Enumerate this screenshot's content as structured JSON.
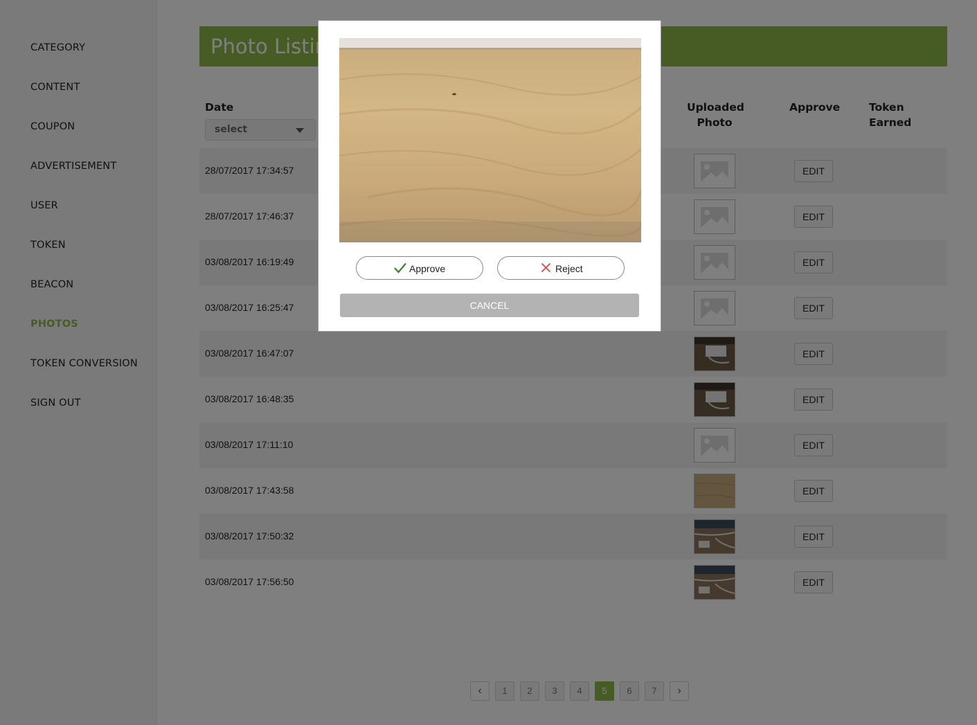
{
  "sidebar": {
    "items": [
      {
        "label": "CATEGORY"
      },
      {
        "label": "CONTENT"
      },
      {
        "label": "COUPON"
      },
      {
        "label": "ADVERTISEMENT"
      },
      {
        "label": "USER"
      },
      {
        "label": "TOKEN"
      },
      {
        "label": "BEACON"
      },
      {
        "label": "PHOTOS",
        "active": true
      },
      {
        "label": "TOKEN CONVERSION"
      },
      {
        "label": "SIGN OUT"
      }
    ]
  },
  "page": {
    "title": "Photo Listing"
  },
  "table": {
    "headers": {
      "date": "Date",
      "uploaded_photo": [
        "Uploaded",
        "Photo"
      ],
      "approve": "Approve",
      "token_earned": [
        "Token",
        "Earned"
      ]
    },
    "date_filter": {
      "selected": "select"
    },
    "edit_label": "EDIT",
    "rows": [
      {
        "date": "28/07/2017 17:34:57",
        "photo": "placeholder-icon"
      },
      {
        "date": "28/07/2017 17:46:37",
        "photo": "placeholder-icon"
      },
      {
        "date": "03/08/2017 16:19:49",
        "photo": "placeholder-icon"
      },
      {
        "date": "03/08/2017 16:25:47",
        "photo": "placeholder-icon"
      },
      {
        "date": "03/08/2017 16:47:07",
        "photo": "device-photo"
      },
      {
        "date": "03/08/2017 16:48:35",
        "photo": "device-photo"
      },
      {
        "date": "03/08/2017 17:11:10",
        "photo": "placeholder-icon"
      },
      {
        "date": "03/08/2017 17:43:58",
        "photo": "wood-photo"
      },
      {
        "date": "03/08/2017 17:50:32",
        "photo": "cables-photo"
      },
      {
        "date": "03/08/2017 17:56:50",
        "photo": "cables-photo"
      }
    ]
  },
  "pagination": {
    "prev": "‹",
    "next": "›",
    "pages": [
      "1",
      "2",
      "3",
      "4",
      "5",
      "6",
      "7"
    ],
    "current": "5"
  },
  "modal": {
    "photo": "wood-photo",
    "approve_label": "Approve",
    "reject_label": "Reject",
    "cancel_label": "CANCEL"
  },
  "colors": {
    "accent": "#8fb84a",
    "approve_icon": "#3a7d2a",
    "reject_icon": "#d9534f",
    "cancel_bg": "#b3b3b3"
  }
}
